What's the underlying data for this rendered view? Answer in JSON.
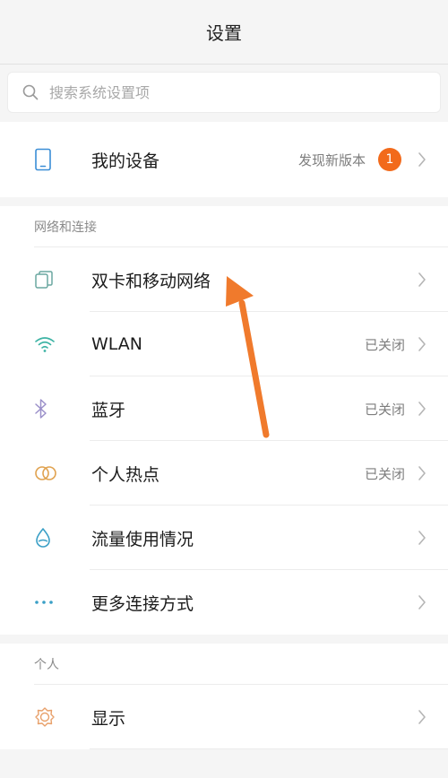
{
  "header": {
    "title": "设置"
  },
  "search": {
    "placeholder": "搜索系统设置项"
  },
  "device": {
    "label": "我的设备",
    "status": "发现新版本",
    "badge_count": "1"
  },
  "network_section": {
    "title": "网络和连接",
    "items": [
      {
        "label": "双卡和移动网络",
        "value": "",
        "icon": "dual-sim-icon"
      },
      {
        "label": "WLAN",
        "value": "已关闭",
        "icon": "wifi-icon"
      },
      {
        "label": "蓝牙",
        "value": "已关闭",
        "icon": "bluetooth-icon"
      },
      {
        "label": "个人热点",
        "value": "已关闭",
        "icon": "hotspot-icon"
      },
      {
        "label": "流量使用情况",
        "value": "",
        "icon": "data-usage-icon"
      },
      {
        "label": "更多连接方式",
        "value": "",
        "icon": "more-dots-icon"
      }
    ]
  },
  "personal_section": {
    "title": "个人",
    "items": [
      {
        "label": "显示",
        "value": "",
        "icon": "display-sun-icon"
      }
    ]
  },
  "colors": {
    "badge": "#f26a1b",
    "annotation_arrow": "#f07a2c",
    "sim_icon": "#6aa7a0",
    "wifi_icon": "#3cb3a4",
    "bluetooth_icon": "#9a8fc9",
    "hotspot_icon": "#e0a24f",
    "data_icon": "#3a9fc6",
    "more_icon": "#3a9fc6",
    "display_icon": "#e8a06a"
  }
}
